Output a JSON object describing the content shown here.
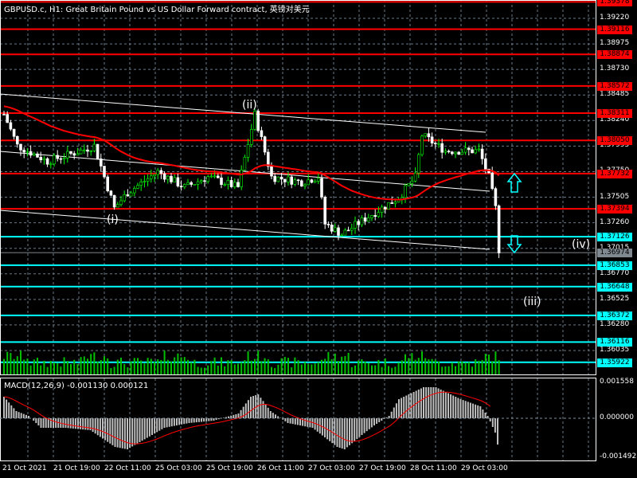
{
  "header": {
    "title": "GBPUSD.c, H1:  Great Britain Pound vs US Dollar Forward contract, 英镑对美元"
  },
  "colors": {
    "resistance": "#ff0000",
    "support": "#00ffff",
    "current": "#808890",
    "candle": "#00ff00",
    "ma": "#ff0000",
    "macd_hist": "#c0c0c0",
    "signal": "#ff0000"
  },
  "price_axis": {
    "labels": [
      "1.39220",
      "1.38975",
      "1.38730",
      "1.38485",
      "1.38240",
      "1.37995",
      "1.37750",
      "1.37505",
      "1.37260",
      "1.37015",
      "1.36770",
      "1.36525",
      "1.36280",
      "1.36035"
    ],
    "resistance_levels": [
      "1.39378",
      "1.39116",
      "1.38874",
      "1.38572",
      "1.38311",
      "1.38050",
      "1.37732",
      "1.37394"
    ],
    "support_levels": [
      "1.37126",
      "1.36853",
      "1.36648",
      "1.36372",
      "1.36116",
      "1.35922"
    ],
    "current_price": "1.36974"
  },
  "time_axis": [
    "21 Oct 2021",
    "21 Oct 19:00",
    "22 Oct 11:00",
    "25 Oct 03:00",
    "25 Oct 19:00",
    "26 Oct 11:00",
    "27 Oct 03:00",
    "27 Oct 19:00",
    "28 Oct 11:00",
    "29 Oct 03:00"
  ],
  "waves": {
    "i": "(i)",
    "ii": "(ii)",
    "iii": "(iii)",
    "iv": "(iv)"
  },
  "macd": {
    "title": "MACD(12,26,9) -0.001130 0.000121",
    "max_label": "0.001558",
    "zero_label": "0.000000",
    "min_label": "-0.001492"
  },
  "chart_data": {
    "type": "candlestick",
    "symbol": "GBPUSD.c",
    "timeframe": "H1",
    "ylim": [
      1.3585,
      1.394
    ],
    "price_path": [
      [
        0,
        1.383
      ],
      [
        4,
        1.38
      ],
      [
        13,
        1.3785
      ],
      [
        23,
        1.3795
      ],
      [
        27,
        1.38
      ],
      [
        33,
        1.374
      ],
      [
        37,
        1.3755
      ],
      [
        46,
        1.3775
      ],
      [
        54,
        1.376
      ],
      [
        61,
        1.377
      ],
      [
        70,
        1.376
      ],
      [
        75,
        1.383
      ],
      [
        80,
        1.377
      ],
      [
        89,
        1.3765
      ],
      [
        94,
        1.377
      ],
      [
        96,
        1.3725
      ],
      [
        101,
        1.3715
      ],
      [
        108,
        1.373
      ],
      [
        118,
        1.375
      ],
      [
        123,
        1.377
      ],
      [
        125,
        1.381
      ],
      [
        132,
        1.3795
      ],
      [
        142,
        1.3795
      ],
      [
        145,
        1.377
      ],
      [
        147,
        1.374
      ],
      [
        148,
        1.3697
      ]
    ],
    "macd_path": [
      [
        0,
        0.0009
      ],
      [
        5,
        0.0003
      ],
      [
        10,
        0.0001
      ],
      [
        15,
        -0.0004
      ],
      [
        25,
        -0.0004
      ],
      [
        35,
        -0.0005
      ],
      [
        45,
        -0.0012
      ],
      [
        50,
        -0.0013
      ],
      [
        60,
        -0.0007
      ],
      [
        65,
        -0.0004
      ],
      [
        75,
        -0.0002
      ],
      [
        85,
        -0.0001
      ],
      [
        95,
        0.0002
      ],
      [
        100,
        0.0009
      ],
      [
        103,
        0.001
      ],
      [
        108,
        0.0003
      ],
      [
        115,
        -0.0002
      ],
      [
        125,
        -0.0004
      ],
      [
        135,
        -0.0012
      ],
      [
        138,
        -0.0013
      ],
      [
        145,
        -0.0007
      ],
      [
        150,
        -0.0003
      ],
      [
        156,
        0.0001
      ],
      [
        160,
        0.0008
      ],
      [
        170,
        0.0013
      ],
      [
        175,
        0.0013
      ],
      [
        185,
        0.0008
      ],
      [
        193,
        0.0005
      ],
      [
        196,
        0.0001
      ],
      [
        199,
        -0.0006
      ],
      [
        200,
        -0.0011
      ]
    ]
  }
}
